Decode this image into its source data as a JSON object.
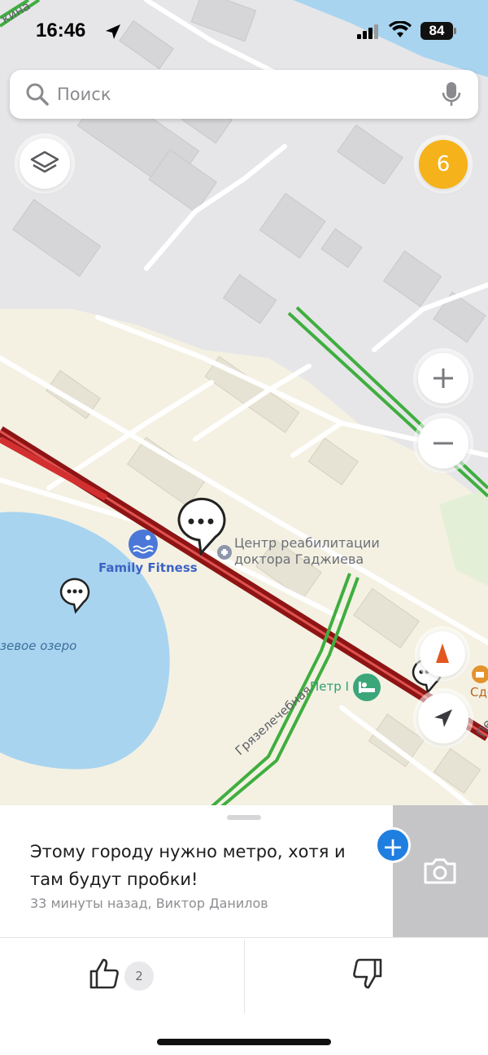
{
  "status_bar": {
    "time": "16:46",
    "battery": "84"
  },
  "search": {
    "placeholder": "Поиск"
  },
  "map": {
    "event_count": "6",
    "labels": {
      "rehab_center": "Центр реабилитации доктора Гаджиева",
      "fitness": "Family Fitness",
      "lake": "зевое озеро",
      "petr": "Петр I",
      "cafe": "Сделай",
      "street": "Грязелечебная",
      "street_top": "кина",
      "street_edge": "Пе"
    }
  },
  "comment": {
    "text": "Этому городу нужно метро, хотя и там будут пробки!",
    "meta": "33 минуты назад, Виктор Данилов",
    "likes": "2"
  },
  "colors": {
    "water": "#a8d4f0",
    "traffic_red": "#8e1414",
    "traffic_green": "#3fae3f",
    "accent": "#f5b21a",
    "primary": "#1f7fe0"
  }
}
